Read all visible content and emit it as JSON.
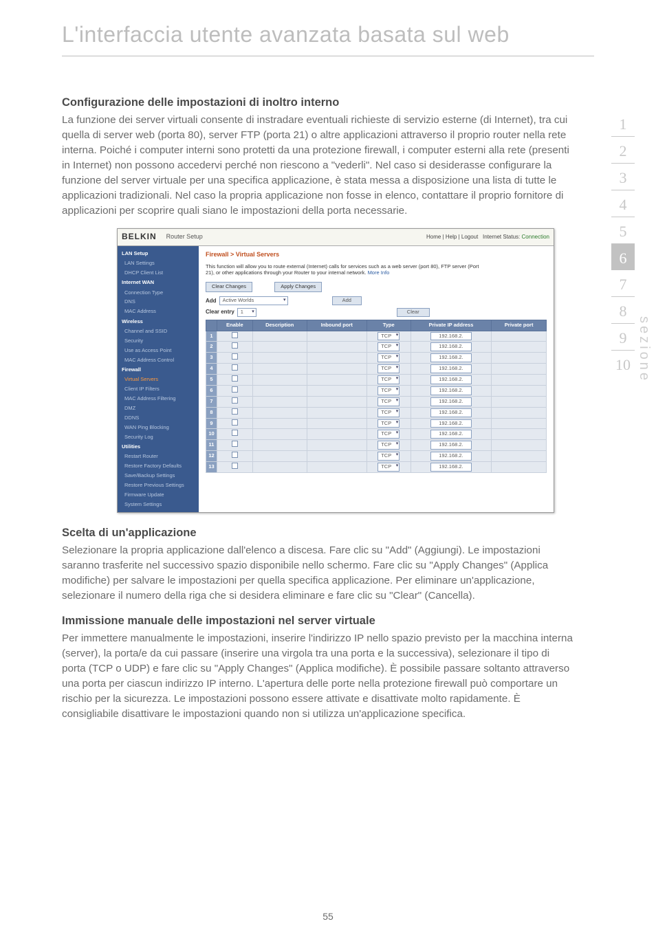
{
  "page": {
    "title": "L'interfaccia utente avanzata basata sul web",
    "number": "55"
  },
  "sideLabel": "sezione",
  "tabs": [
    "1",
    "2",
    "3",
    "4",
    "5",
    "6",
    "7",
    "8",
    "9",
    "10"
  ],
  "activeTab": "6",
  "sectionA": {
    "heading": "Configurazione delle impostazioni di inoltro interno",
    "body": "La funzione dei server virtuali consente di instradare eventuali richieste di servizio esterne (di Internet), tra cui quella di server web (porta 80), server FTP (porta 21) o altre applicazioni attraverso il proprio router nella rete interna. Poiché i computer interni sono protetti da una protezione firewall, i computer esterni alla rete (presenti in Internet) non possono accedervi perché non riescono a \"vederli\". Nel caso si desiderasse configurare la funzione del server virtuale per una specifica applicazione, è stata messa a disposizione una lista di tutte le applicazioni tradizionali. Nel caso la propria applicazione non fosse in elenco, contattare il proprio fornitore di applicazioni per scoprire quali siano le impostazioni della porta necessarie."
  },
  "sectionB": {
    "heading": "Scelta di un'applicazione",
    "body": "Selezionare la propria applicazione dall'elenco a discesa. Fare clic su \"Add\" (Aggiungi). Le impostazioni saranno trasferite nel successivo spazio disponibile nello schermo. Fare clic su \"Apply Changes\" (Applica modifiche) per salvare le impostazioni per quella specifica applicazione. Per eliminare un'applicazione, selezionare il numero della riga che si desidera eliminare e fare clic su \"Clear\" (Cancella)."
  },
  "sectionC": {
    "heading": "Immissione manuale delle impostazioni nel server virtuale",
    "body": "Per immettere manualmente le impostazioni, inserire l'indirizzo IP nello spazio previsto per la macchina interna (server), la porta/e da cui passare (inserire una virgola tra una porta e la successiva), selezionare il tipo di porta (TCP o UDP) e fare clic su \"Apply Changes\" (Applica modifiche). È possibile passare soltanto attraverso una porta per ciascun indirizzo IP interno. L'apertura delle porte nella protezione firewall può comportare un rischio per la sicurezza. Le impostazioni possono essere attivate e disattivate molto rapidamente. È consigliabile disattivare le impostazioni quando non si utilizza un'applicazione specifica."
  },
  "screenshot": {
    "brand": "BELKIN",
    "headerTitle": "Router Setup",
    "topLinks": {
      "home": "Home",
      "help": "Help",
      "logout": "Logout",
      "statusLabel": "Internet Status:",
      "statusValue": "Connection"
    },
    "sidebar": {
      "g1": "LAN Setup",
      "g1_items": [
        "LAN Settings",
        "DHCP Client List"
      ],
      "g2": "Internet WAN",
      "g2_items": [
        "Connection Type",
        "DNS",
        "MAC Address"
      ],
      "g3": "Wireless",
      "g3_items": [
        "Channel and SSID",
        "Security",
        "Use as Access Point",
        "MAC Address Control"
      ],
      "g4": "Firewall",
      "g4_items": [
        "Virtual Servers",
        "Client IP Filters",
        "MAC Address Filtering",
        "DMZ",
        "DDNS",
        "WAN Ping Blocking",
        "Security Log"
      ],
      "g5": "Utilities",
      "g5_items": [
        "Restart Router",
        "Restore Factory Defaults",
        "Save/Backup Settings",
        "Restore Previous Settings",
        "Firmware Update",
        "System Settings"
      ]
    },
    "breadcrumb": "Firewall > Virtual Servers",
    "desc": "This function will allow you to route external (Internet) calls for services such as a web server (port 80), FTP server (Port 21), or other applications through your Router to your internal network.",
    "moreInfo": "More Info",
    "buttons": {
      "clearChanges": "Clear Changes",
      "applyChanges": "Apply Changes",
      "add": "Add",
      "clear": "Clear"
    },
    "addRow": {
      "addLabel": "Add",
      "addValue": "Active Worlds",
      "clearLabel": "Clear entry",
      "clearValue": "1"
    },
    "table": {
      "headers": [
        "",
        "Enable",
        "Description",
        "Inbound port",
        "Type",
        "Private IP address",
        "Private port"
      ],
      "typeValue": "TCP",
      "ipPrefix": "192.168.2.",
      "rows": [
        "1",
        "2",
        "3",
        "4",
        "5",
        "6",
        "7",
        "8",
        "9",
        "10",
        "11",
        "12",
        "13"
      ]
    }
  }
}
